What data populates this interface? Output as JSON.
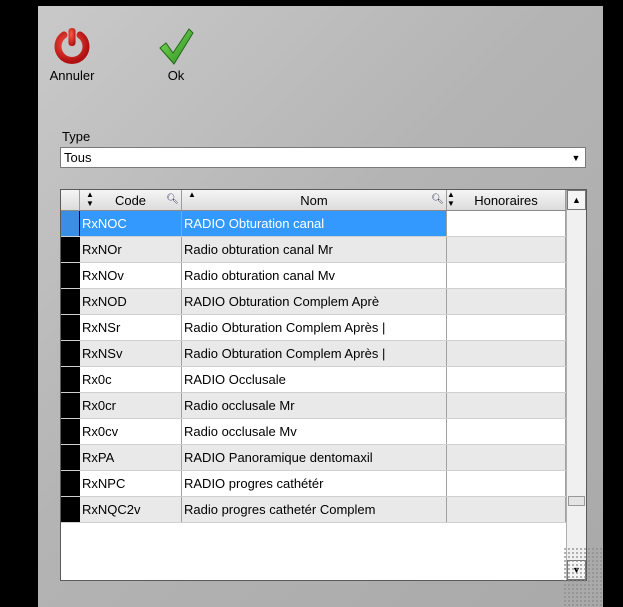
{
  "toolbar": {
    "cancel_label": "Annuler",
    "ok_label": "Ok"
  },
  "type": {
    "label": "Type",
    "value": "Tous"
  },
  "grid": {
    "headers": {
      "code": "Code",
      "nom": "Nom",
      "honoraires": "Honoraires"
    },
    "rows": [
      {
        "code": "RxNOC",
        "nom": "RADIO Obturation canal",
        "honoraires": ""
      },
      {
        "code": "RxNOr",
        "nom": "Radio obturation canal Mr",
        "honoraires": ""
      },
      {
        "code": "RxNOv",
        "nom": "Radio obturation canal Mv",
        "honoraires": ""
      },
      {
        "code": "RxNOD",
        "nom": "RADIO Obturation Complem  Aprè",
        "honoraires": ""
      },
      {
        "code": "RxNSr",
        "nom": "Radio Obturation Complem Après |",
        "honoraires": ""
      },
      {
        "code": "RxNSv",
        "nom": "Radio Obturation Complem Après |",
        "honoraires": ""
      },
      {
        "code": "Rx0c",
        "nom": "RADIO Occlusale",
        "honoraires": ""
      },
      {
        "code": "Rx0cr",
        "nom": "Radio occlusale Mr",
        "honoraires": ""
      },
      {
        "code": "Rx0cv",
        "nom": "Radio occlusale Mv",
        "honoraires": ""
      },
      {
        "code": "RxPA",
        "nom": "RADIO Panoramique dentomaxil",
        "honoraires": ""
      },
      {
        "code": "RxNPC",
        "nom": "RADIO progres cathétér",
        "honoraires": ""
      },
      {
        "code": "RxNQC2v",
        "nom": "Radio progres cathetér Complem",
        "honoraires": ""
      }
    ]
  },
  "icons": {
    "cancel": "power-icon",
    "ok": "checkmark-icon"
  },
  "colors": {
    "selection": "#3399ff",
    "power_red": "#d42020",
    "check_green": "#3aa62a"
  }
}
